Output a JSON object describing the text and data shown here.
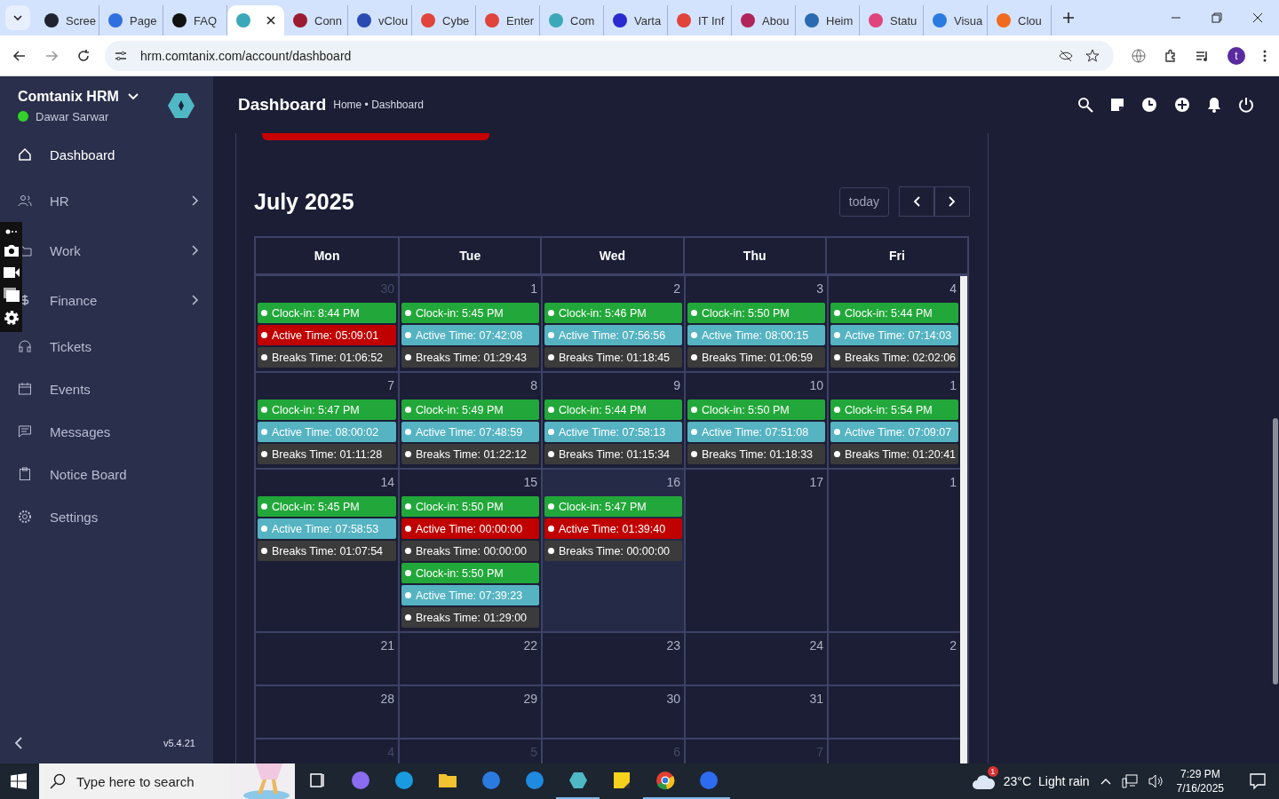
{
  "browser": {
    "tabs": [
      {
        "title": "Scree",
        "selected": false,
        "color": "#1f2430"
      },
      {
        "title": "Page",
        "selected": false,
        "color": "#2f6fe0"
      },
      {
        "title": "FAQ",
        "selected": false,
        "color": "#111111"
      },
      {
        "selected": true,
        "color": "#3aa8b8"
      },
      {
        "title": "Conn",
        "selected": false,
        "color": "#9b1b30"
      },
      {
        "title": "vClou",
        "selected": false,
        "color": "#2a4bb0"
      },
      {
        "title": "Cybe",
        "selected": false,
        "color": "#e0443a"
      },
      {
        "title": "Enter",
        "selected": false,
        "color": "#e0443a"
      },
      {
        "title": "Com",
        "selected": false,
        "color": "#3aa8b8"
      },
      {
        "title": "Varta",
        "selected": false,
        "color": "#2a2ad0"
      },
      {
        "title": "IT Inf",
        "selected": false,
        "color": "#e0443a"
      },
      {
        "title": "Abou",
        "selected": false,
        "color": "#b0245a"
      },
      {
        "title": "Heim",
        "selected": false,
        "color": "#2a6ab0"
      },
      {
        "title": "Statu",
        "selected": false,
        "color": "#e0447a"
      },
      {
        "title": "Visua",
        "selected": false,
        "color": "#2a7ae0"
      },
      {
        "title": "Clou",
        "selected": false,
        "color": "#f06a20"
      }
    ],
    "url": "hrm.comtanix.com/account/dashboard",
    "profile": "t"
  },
  "app": {
    "brand": "Comtanix HRM",
    "user": "Dawar Sarwar",
    "online": true,
    "version": "v5.4.21",
    "sidebar": [
      {
        "label": "Dashboard",
        "selected": true,
        "has_children": false
      },
      {
        "label": "HR",
        "selected": false,
        "has_children": true
      },
      {
        "label": "Work",
        "selected": false,
        "has_children": true
      },
      {
        "label": "Finance",
        "selected": false,
        "has_children": true
      },
      {
        "label": "Tickets",
        "selected": false,
        "has_children": false
      },
      {
        "label": "Events",
        "selected": false,
        "has_children": false
      },
      {
        "label": "Messages",
        "selected": false,
        "has_children": false
      },
      {
        "label": "Notice Board",
        "selected": false,
        "has_children": false
      },
      {
        "label": "Settings",
        "selected": false,
        "has_children": false
      }
    ]
  },
  "header": {
    "title": "Dashboard",
    "breadcrumb": "Home • Dashboard"
  },
  "calendar": {
    "title": "July 2025",
    "today_button": "today",
    "weekdays": [
      "Mon",
      "Tue",
      "Wed",
      "Thu",
      "Fri"
    ],
    "weeks": [
      {
        "days": [
          {
            "number": "30",
            "other_month": true,
            "today": false,
            "events": [
              {
                "text": "Clock-in: 8:44 PM",
                "color": "#22a83a"
              },
              {
                "text": "Active Time: 05:09:01",
                "color": "#c00000"
              },
              {
                "text": "Breaks Time: 01:06:52",
                "color": "#3b3b3b"
              }
            ]
          },
          {
            "number": "1",
            "other_month": false,
            "today": false,
            "events": [
              {
                "text": "Clock-in: 5:45 PM",
                "color": "#22a83a"
              },
              {
                "text": "Active Time: 07:42:08",
                "color": "#55b3c2"
              },
              {
                "text": "Breaks Time: 01:29:43",
                "color": "#3b3b3b"
              }
            ]
          },
          {
            "number": "2",
            "other_month": false,
            "today": false,
            "events": [
              {
                "text": "Clock-in: 5:46 PM",
                "color": "#22a83a"
              },
              {
                "text": "Active Time: 07:56:56",
                "color": "#55b3c2"
              },
              {
                "text": "Breaks Time: 01:18:45",
                "color": "#3b3b3b"
              }
            ]
          },
          {
            "number": "3",
            "other_month": false,
            "today": false,
            "events": [
              {
                "text": "Clock-in: 5:50 PM",
                "color": "#22a83a"
              },
              {
                "text": "Active Time: 08:00:15",
                "color": "#55b3c2"
              },
              {
                "text": "Breaks Time: 01:06:59",
                "color": "#3b3b3b"
              }
            ]
          },
          {
            "number": "4",
            "other_month": false,
            "today": false,
            "events": [
              {
                "text": "Clock-in: 5:44 PM",
                "color": "#22a83a"
              },
              {
                "text": "Active Time: 07:14:03",
                "color": "#55b3c2"
              },
              {
                "text": "Breaks Time: 02:02:06",
                "color": "#3b3b3b"
              }
            ]
          }
        ]
      },
      {
        "days": [
          {
            "number": "7",
            "other_month": false,
            "today": false,
            "events": [
              {
                "text": "Clock-in: 5:47 PM",
                "color": "#22a83a"
              },
              {
                "text": "Active Time: 08:00:02",
                "color": "#55b3c2"
              },
              {
                "text": "Breaks Time: 01:11:28",
                "color": "#3b3b3b"
              }
            ]
          },
          {
            "number": "8",
            "other_month": false,
            "today": false,
            "events": [
              {
                "text": "Clock-in: 5:49 PM",
                "color": "#22a83a"
              },
              {
                "text": "Active Time: 07:48:59",
                "color": "#55b3c2"
              },
              {
                "text": "Breaks Time: 01:22:12",
                "color": "#3b3b3b"
              }
            ]
          },
          {
            "number": "9",
            "other_month": false,
            "today": false,
            "events": [
              {
                "text": "Clock-in: 5:44 PM",
                "color": "#22a83a"
              },
              {
                "text": "Active Time: 07:58:13",
                "color": "#55b3c2"
              },
              {
                "text": "Breaks Time: 01:15:34",
                "color": "#3b3b3b"
              }
            ]
          },
          {
            "number": "10",
            "other_month": false,
            "today": false,
            "events": [
              {
                "text": "Clock-in: 5:50 PM",
                "color": "#22a83a"
              },
              {
                "text": "Active Time: 07:51:08",
                "color": "#55b3c2"
              },
              {
                "text": "Breaks Time: 01:18:33",
                "color": "#3b3b3b"
              }
            ]
          },
          {
            "number": "1",
            "other_month": false,
            "today": false,
            "events": [
              {
                "text": "Clock-in: 5:54 PM",
                "color": "#22a83a"
              },
              {
                "text": "Active Time: 07:09:07",
                "color": "#55b3c2"
              },
              {
                "text": "Breaks Time: 01:20:41",
                "color": "#3b3b3b"
              }
            ]
          }
        ]
      },
      {
        "days": [
          {
            "number": "14",
            "other_month": false,
            "today": false,
            "events": [
              {
                "text": "Clock-in: 5:45 PM",
                "color": "#22a83a"
              },
              {
                "text": "Active Time: 07:58:53",
                "color": "#55b3c2"
              },
              {
                "text": "Breaks Time: 01:07:54",
                "color": "#3b3b3b"
              }
            ]
          },
          {
            "number": "15",
            "other_month": false,
            "today": false,
            "events": [
              {
                "text": "Clock-in: 5:50 PM",
                "color": "#22a83a"
              },
              {
                "text": "Active Time: 00:00:00",
                "color": "#c00000"
              },
              {
                "text": "Breaks Time: 00:00:00",
                "color": "#3b3b3b"
              },
              {
                "text": "Clock-in: 5:50 PM",
                "color": "#22a83a"
              },
              {
                "text": "Active Time: 07:39:23",
                "color": "#55b3c2"
              },
              {
                "text": "Breaks Time: 01:29:00",
                "color": "#3b3b3b"
              }
            ]
          },
          {
            "number": "16",
            "other_month": false,
            "today": true,
            "events": [
              {
                "text": "Clock-in: 5:47 PM",
                "color": "#22a83a"
              },
              {
                "text": "Active Time: 01:39:40",
                "color": "#c00000"
              },
              {
                "text": "Breaks Time: 00:00:00",
                "color": "#3b3b3b"
              }
            ]
          },
          {
            "number": "17",
            "other_month": false,
            "today": false
          },
          {
            "number": "1",
            "other_month": false,
            "today": false
          }
        ]
      },
      {
        "days": [
          {
            "number": "21",
            "other_month": false,
            "today": false
          },
          {
            "number": "22",
            "other_month": false,
            "today": false
          },
          {
            "number": "23",
            "other_month": false,
            "today": false
          },
          {
            "number": "24",
            "other_month": false,
            "today": false
          },
          {
            "number": "2",
            "other_month": false,
            "today": false
          }
        ]
      },
      {
        "days": [
          {
            "number": "28",
            "other_month": false,
            "today": false
          },
          {
            "number": "29",
            "other_month": false,
            "today": false
          },
          {
            "number": "30",
            "other_month": false,
            "today": false
          },
          {
            "number": "31",
            "other_month": false,
            "today": false
          },
          {
            "today": false
          }
        ]
      },
      {
        "days": [
          {
            "number": "4",
            "other_month": true,
            "today": false
          },
          {
            "number": "5",
            "other_month": true,
            "today": false
          },
          {
            "number": "6",
            "other_month": true,
            "today": false
          },
          {
            "number": "7",
            "other_month": true,
            "today": false
          },
          {
            "today": false
          }
        ]
      }
    ]
  },
  "taskbar": {
    "search_placeholder": "Type here to search",
    "apps": [
      {
        "kind": "taskview",
        "running": false
      },
      {
        "kind": "copilot",
        "running": false
      },
      {
        "kind": "edge",
        "running": false
      },
      {
        "kind": "folder",
        "running": false
      },
      {
        "kind": "store",
        "running": false
      },
      {
        "kind": "mail",
        "running": false
      },
      {
        "kind": "hexagon",
        "running": true
      },
      {
        "kind": "note",
        "running": false
      },
      {
        "kind": "chrome",
        "running": true
      },
      {
        "kind": "zoom",
        "running": true
      }
    ],
    "weather_badge": "1",
    "temperature": "23°C",
    "weather": "Light rain",
    "time": "7:29 PM",
    "date": "7/16/2025"
  }
}
